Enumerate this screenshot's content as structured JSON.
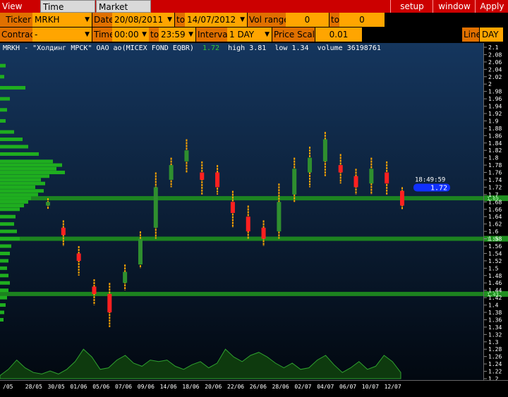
{
  "menubar": {
    "tabs": [
      "View DOM",
      "Time Interval",
      "Market Watch"
    ],
    "active_tab": "Time Interval",
    "buttons": [
      "setup",
      "window",
      "Apply"
    ]
  },
  "params": {
    "ticker_label": "Ticker",
    "ticker": "MRKH",
    "date_label": "Date",
    "date_from": "20/08/2011",
    "to_label": "to",
    "date_to": "14/07/2012",
    "vol_range_label": "Vol range",
    "vol_from": "0",
    "vol_to_label": "to",
    "vol_to": "0",
    "contract_label": "Contract",
    "contract": "-",
    "time_label": "Time",
    "time_from": "00:00",
    "time_to_label": "to",
    "time_to": "23:59",
    "interval_label": "Interval",
    "interval": "1 DAY",
    "price_scale_label": "Price Scale",
    "price_scale": "0.01",
    "line_label": "Line",
    "line": "DAY"
  },
  "chart_header": {
    "instrument": "MRKH - \"Холдинг МРСК\" ОАО ао(MICEX FOND EQBR)",
    "last": "1.72",
    "high_text": "high 3.81",
    "low_text": "low 1.34",
    "volume_text": "volume 36198761"
  },
  "chart_data": {
    "type": "bar",
    "y_ticks": [
      "2.1",
      "2.08",
      "2.06",
      "2.04",
      "2.02",
      "2",
      "1.98",
      "1.96",
      "1.94",
      "1.92",
      "1.9",
      "1.88",
      "1.86",
      "1.84",
      "1.82",
      "1.8",
      "1.78",
      "1.76",
      "1.74",
      "1.72",
      "1.7",
      "1.68",
      "1.66",
      "1.64",
      "1.62",
      "1.6",
      "1.58",
      "1.56",
      "1.54",
      "1.52",
      "1.5",
      "1.48",
      "1.46",
      "1.44",
      "1.42",
      "1.4",
      "1.38",
      "1.36",
      "1.34",
      "1.32",
      "1.3",
      "1.28",
      "1.26",
      "1.24",
      "1.22",
      "1.2"
    ],
    "ylim": [
      1.2,
      2.1
    ],
    "x_ticks": [
      "/05",
      "28/05",
      "30/05",
      "01/06",
      "05/06",
      "07/06",
      "09/06",
      "14/06",
      "18/06",
      "20/06",
      "22/06",
      "26/06",
      "28/06",
      "02/07",
      "04/07",
      "06/07",
      "10/07",
      "12/07"
    ],
    "time_label": "18:49:59",
    "last_price": "1.72",
    "level_lines": [
      {
        "price": 1.69,
        "label": "1.69"
      },
      {
        "price": 1.58,
        "label": "1.58"
      },
      {
        "price": 1.43,
        "label": "1.43"
      }
    ],
    "candles": [
      {
        "low": 1.66,
        "high": 1.69,
        "open": 1.67,
        "close": 1.68,
        "up": true
      },
      {
        "low": 1.56,
        "high": 1.63,
        "open": 1.59,
        "close": 1.61,
        "up": false
      },
      {
        "low": 1.48,
        "high": 1.56,
        "open": 1.52,
        "close": 1.54,
        "up": false
      },
      {
        "low": 1.4,
        "high": 1.47,
        "open": 1.45,
        "close": 1.43,
        "up": false
      },
      {
        "low": 1.34,
        "high": 1.46,
        "open": 1.43,
        "close": 1.38,
        "up": false
      },
      {
        "low": 1.44,
        "high": 1.51,
        "open": 1.46,
        "close": 1.49,
        "up": true
      },
      {
        "low": 1.5,
        "high": 1.6,
        "open": 1.51,
        "close": 1.58,
        "up": true
      },
      {
        "low": 1.58,
        "high": 1.76,
        "open": 1.61,
        "close": 1.72,
        "up": true
      },
      {
        "low": 1.72,
        "high": 1.8,
        "open": 1.74,
        "close": 1.78,
        "up": true
      },
      {
        "low": 1.76,
        "high": 1.85,
        "open": 1.79,
        "close": 1.82,
        "up": true
      },
      {
        "low": 1.7,
        "high": 1.79,
        "open": 1.76,
        "close": 1.74,
        "up": false
      },
      {
        "low": 1.7,
        "high": 1.78,
        "open": 1.76,
        "close": 1.72,
        "up": false
      },
      {
        "low": 1.61,
        "high": 1.71,
        "open": 1.68,
        "close": 1.65,
        "up": false
      },
      {
        "low": 1.58,
        "high": 1.67,
        "open": 1.64,
        "close": 1.6,
        "up": false
      },
      {
        "low": 1.56,
        "high": 1.63,
        "open": 1.61,
        "close": 1.58,
        "up": false
      },
      {
        "low": 1.58,
        "high": 1.73,
        "open": 1.6,
        "close": 1.68,
        "up": true
      },
      {
        "low": 1.68,
        "high": 1.8,
        "open": 1.7,
        "close": 1.77,
        "up": true
      },
      {
        "low": 1.72,
        "high": 1.83,
        "open": 1.76,
        "close": 1.8,
        "up": true
      },
      {
        "low": 1.75,
        "high": 1.87,
        "open": 1.79,
        "close": 1.85,
        "up": true
      },
      {
        "low": 1.73,
        "high": 1.81,
        "open": 1.78,
        "close": 1.76,
        "up": false
      },
      {
        "low": 1.7,
        "high": 1.77,
        "open": 1.75,
        "close": 1.72,
        "up": false
      },
      {
        "low": 1.7,
        "high": 1.8,
        "open": 1.73,
        "close": 1.77,
        "up": true
      },
      {
        "low": 1.7,
        "high": 1.79,
        "open": 1.76,
        "close": 1.73,
        "up": false
      },
      {
        "low": 1.66,
        "high": 1.72,
        "open": 1.71,
        "close": 1.67,
        "up": false
      }
    ],
    "volume_profile": [
      {
        "price": 2.05,
        "w": 8
      },
      {
        "price": 2.02,
        "w": 6
      },
      {
        "price": 1.99,
        "w": 36
      },
      {
        "price": 1.96,
        "w": 14
      },
      {
        "price": 1.93,
        "w": 10
      },
      {
        "price": 1.9,
        "w": 8
      },
      {
        "price": 1.87,
        "w": 20
      },
      {
        "price": 1.85,
        "w": 32
      },
      {
        "price": 1.83,
        "w": 40
      },
      {
        "price": 1.81,
        "w": 55
      },
      {
        "price": 1.79,
        "w": 75
      },
      {
        "price": 1.78,
        "w": 88
      },
      {
        "price": 1.77,
        "w": 80
      },
      {
        "price": 1.76,
        "w": 92
      },
      {
        "price": 1.75,
        "w": 70
      },
      {
        "price": 1.74,
        "w": 58
      },
      {
        "price": 1.73,
        "w": 64
      },
      {
        "price": 1.72,
        "w": 50
      },
      {
        "price": 1.71,
        "w": 62
      },
      {
        "price": 1.7,
        "w": 54
      },
      {
        "price": 1.69,
        "w": 44
      },
      {
        "price": 1.68,
        "w": 40
      },
      {
        "price": 1.67,
        "w": 34
      },
      {
        "price": 1.66,
        "w": 28
      },
      {
        "price": 1.64,
        "w": 22
      },
      {
        "price": 1.62,
        "w": 20
      },
      {
        "price": 1.6,
        "w": 24
      },
      {
        "price": 1.58,
        "w": 28
      },
      {
        "price": 1.56,
        "w": 16
      },
      {
        "price": 1.54,
        "w": 14
      },
      {
        "price": 1.52,
        "w": 12
      },
      {
        "price": 1.5,
        "w": 10
      },
      {
        "price": 1.48,
        "w": 12
      },
      {
        "price": 1.46,
        "w": 14
      },
      {
        "price": 1.44,
        "w": 12
      },
      {
        "price": 1.42,
        "w": 10
      },
      {
        "price": 1.4,
        "w": 8
      },
      {
        "price": 1.38,
        "w": 6
      },
      {
        "price": 1.36,
        "w": 5
      }
    ],
    "volume_series": [
      0.1,
      0.3,
      0.6,
      0.35,
      0.2,
      0.15,
      0.25,
      0.15,
      0.3,
      0.55,
      0.95,
      0.7,
      0.3,
      0.35,
      0.6,
      0.75,
      0.5,
      0.4,
      0.6,
      0.55,
      0.6,
      0.4,
      0.3,
      0.45,
      0.55,
      0.35,
      0.5,
      0.95,
      0.7,
      0.55,
      0.75,
      0.85,
      0.7,
      0.5,
      0.35,
      0.5,
      0.3,
      0.35,
      0.6,
      0.75,
      0.45,
      0.2,
      0.35,
      0.55,
      0.3,
      0.4,
      0.75,
      0.55,
      0.2
    ],
    "colors": {
      "up": "#ffa500",
      "up_body": "#2f8f2f",
      "down_body": "#ff2020",
      "level_line": "#1f8f1f",
      "volume_fill": "#0e3a0e",
      "volume_line": "#2fa02f",
      "axis_text": "#ffffff",
      "last_badge": "#1030ff"
    }
  }
}
